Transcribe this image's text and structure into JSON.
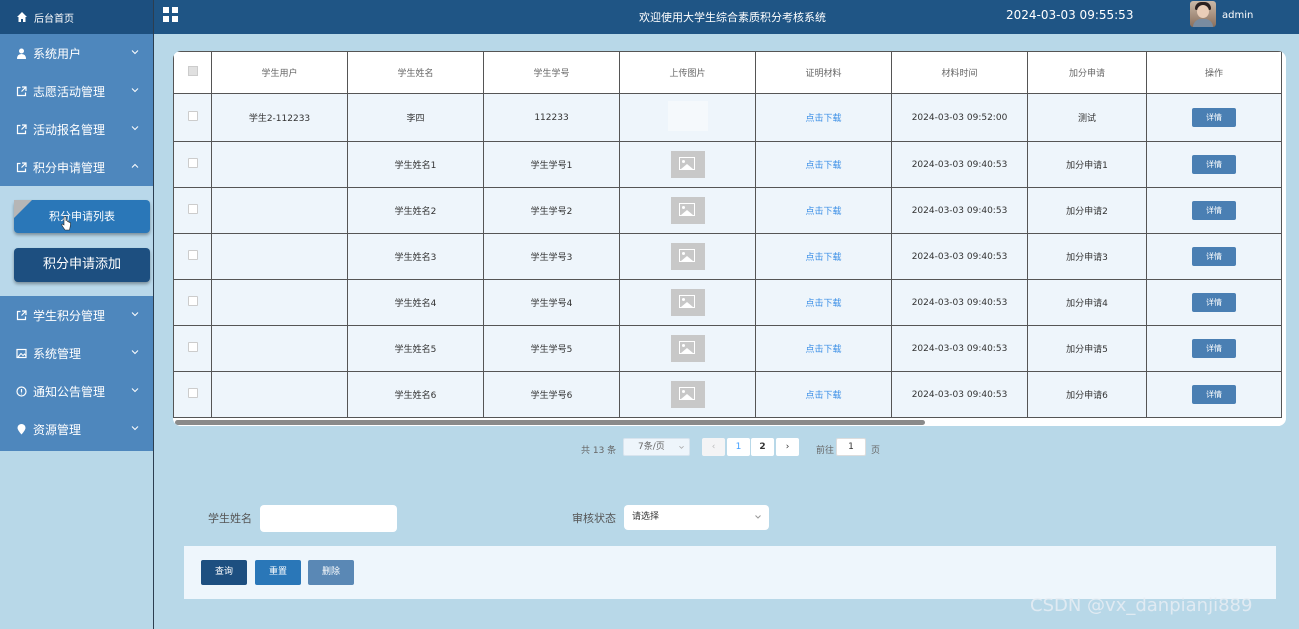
{
  "header": {
    "home_label": "后台首页",
    "title": "欢迎使用大学生综合素质积分考核系统",
    "datetime": "2024-03-03 09:55:53",
    "username": "admin"
  },
  "sidebar": {
    "items": [
      {
        "label": "系统用户",
        "icon": "user-icon"
      },
      {
        "label": "志愿活动管理",
        "icon": "external-link-icon"
      },
      {
        "label": "活动报名管理",
        "icon": "external-link-icon"
      },
      {
        "label": "积分申请管理",
        "icon": "external-link-icon"
      }
    ],
    "submenu": [
      "积分申请列表",
      "积分申请添加"
    ],
    "items_after": [
      {
        "label": "学生积分管理",
        "icon": "external-link-icon"
      },
      {
        "label": "系统管理",
        "icon": "image-icon"
      },
      {
        "label": "通知公告管理",
        "icon": "info-icon"
      },
      {
        "label": "资源管理",
        "icon": "pin-icon"
      }
    ]
  },
  "table": {
    "headers": [
      "学生用户",
      "学生姓名",
      "学生学号",
      "上传图片",
      "证明材料",
      "材料时间",
      "加分申请",
      "操作"
    ],
    "download_label": "点击下载",
    "detail_label": "详情",
    "rows": [
      {
        "user": "学生2-112233",
        "name": "李四",
        "number": "112233",
        "has_image": false,
        "time": "2024-03-03 09:52:00",
        "apply": "测试"
      },
      {
        "user": "",
        "name": "学生姓名1",
        "number": "学生学号1",
        "has_image": true,
        "time": "2024-03-03 09:40:53",
        "apply": "加分申请1"
      },
      {
        "user": "",
        "name": "学生姓名2",
        "number": "学生学号2",
        "has_image": true,
        "time": "2024-03-03 09:40:53",
        "apply": "加分申请2"
      },
      {
        "user": "",
        "name": "学生姓名3",
        "number": "学生学号3",
        "has_image": true,
        "time": "2024-03-03 09:40:53",
        "apply": "加分申请3"
      },
      {
        "user": "",
        "name": "学生姓名4",
        "number": "学生学号4",
        "has_image": true,
        "time": "2024-03-03 09:40:53",
        "apply": "加分申请4"
      },
      {
        "user": "",
        "name": "学生姓名5",
        "number": "学生学号5",
        "has_image": true,
        "time": "2024-03-03 09:40:53",
        "apply": "加分申请5"
      },
      {
        "user": "",
        "name": "学生姓名6",
        "number": "学生学号6",
        "has_image": true,
        "time": "2024-03-03 09:40:53",
        "apply": "加分申请6"
      }
    ]
  },
  "pagination": {
    "total": "共 13 条",
    "page_size": "7条/页",
    "pages": [
      "1",
      "2"
    ],
    "goto_label": "前往",
    "goto_value": "1",
    "page_suffix": "页"
  },
  "search": {
    "name_label": "学生姓名",
    "name_value": "",
    "status_label": "审核状态",
    "status_value": "请选择"
  },
  "actions": {
    "query": "查询",
    "reset": "重置",
    "delete": "删除"
  },
  "watermark": "CSDN @vx_danpianji889",
  "colors": {
    "topbar": "#1f5585",
    "sidebar": "#4e87bd",
    "background": "#b8d8e8",
    "link": "#3a8ee6",
    "button": "#4a7fb3"
  }
}
